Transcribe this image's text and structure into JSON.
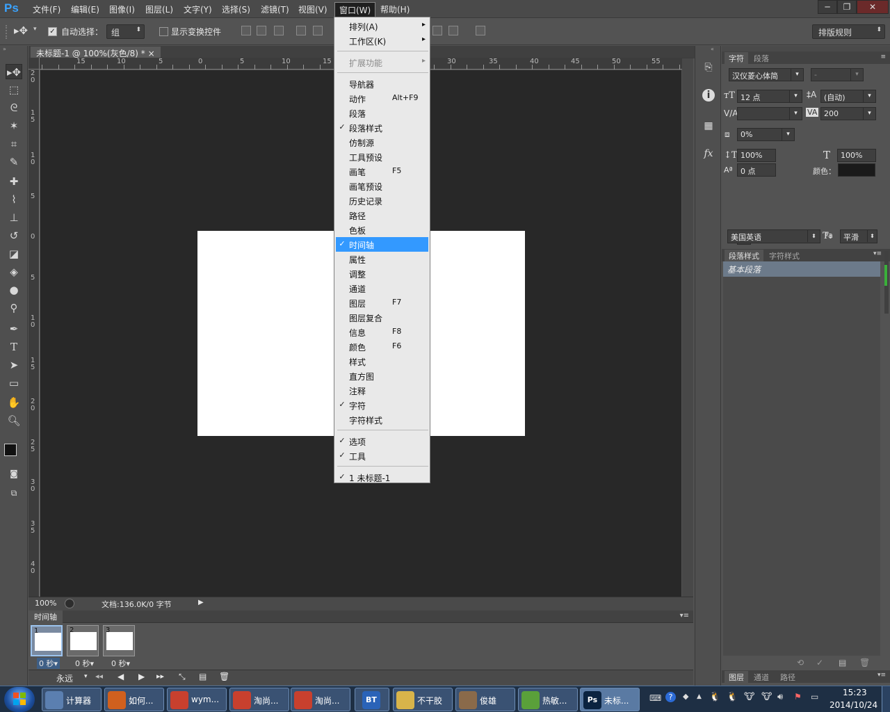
{
  "app": {
    "logo": "Ps"
  },
  "menubar": [
    "文件(F)",
    "编辑(E)",
    "图像(I)",
    "图层(L)",
    "文字(Y)",
    "选择(S)",
    "滤镜(T)",
    "视图(V)",
    "窗口(W)",
    "帮助(H)"
  ],
  "window_controls": [
    "─",
    "❐",
    "✕"
  ],
  "options": {
    "auto_select_label": "自动选择：",
    "auto_select_value": "组",
    "show_transform_label": "显示变换控件",
    "workspace": "排版规则"
  },
  "document": {
    "tab_title": "未标题-1 @ 100%(灰色/8) *",
    "tab_close": "×",
    "zoom": "100%",
    "doc_info": "文档:136.0K/0 字节"
  },
  "ruler": {
    "h_labels": [
      "15",
      "10",
      "5",
      "0",
      "5",
      "10",
      "15",
      "30",
      "35",
      "40",
      "45",
      "50",
      "55"
    ],
    "v_labels": [
      [
        "2",
        "0"
      ],
      [
        "1",
        "5"
      ],
      [
        "1",
        "0"
      ],
      [
        "5"
      ],
      [
        "0"
      ],
      [
        "5"
      ],
      [
        "1",
        "0"
      ],
      [
        "1",
        "5"
      ],
      [
        "2",
        "0"
      ],
      [
        "2",
        "5"
      ],
      [
        "3",
        "0"
      ],
      [
        "3",
        "5"
      ],
      [
        "4",
        "0"
      ]
    ]
  },
  "window_menu": {
    "items": [
      {
        "label": "排列(A)",
        "shortcut": "",
        "type": "sub",
        "check": false
      },
      {
        "label": "工作区(K)",
        "shortcut": "",
        "type": "sub",
        "check": false
      },
      {
        "type": "sep"
      },
      {
        "label": "扩展功能",
        "shortcut": "",
        "type": "disabled-sub",
        "check": false
      },
      {
        "type": "sep"
      },
      {
        "label": "导航器",
        "shortcut": "",
        "check": false
      },
      {
        "label": "动作",
        "shortcut": "Alt+F9",
        "check": false
      },
      {
        "label": "段落",
        "shortcut": "",
        "check": false
      },
      {
        "label": "段落样式",
        "shortcut": "",
        "check": true
      },
      {
        "label": "仿制源",
        "shortcut": "",
        "check": false
      },
      {
        "label": "工具预设",
        "shortcut": "",
        "check": false
      },
      {
        "label": "画笔",
        "shortcut": "F5",
        "check": false
      },
      {
        "label": "画笔预设",
        "shortcut": "",
        "check": false
      },
      {
        "label": "历史记录",
        "shortcut": "",
        "check": false
      },
      {
        "label": "路径",
        "shortcut": "",
        "check": false
      },
      {
        "label": "色板",
        "shortcut": "",
        "check": false
      },
      {
        "label": "时间轴",
        "shortcut": "",
        "check": true,
        "highlighted": true
      },
      {
        "label": "属性",
        "shortcut": "",
        "check": false
      },
      {
        "label": "调整",
        "shortcut": "",
        "check": false
      },
      {
        "label": "通道",
        "shortcut": "",
        "check": false
      },
      {
        "label": "图层",
        "shortcut": "F7",
        "check": false
      },
      {
        "label": "图层复合",
        "shortcut": "",
        "check": false
      },
      {
        "label": "信息",
        "shortcut": "F8",
        "check": false
      },
      {
        "label": "颜色",
        "shortcut": "F6",
        "check": false
      },
      {
        "label": "样式",
        "shortcut": "",
        "check": false
      },
      {
        "label": "直方图",
        "shortcut": "",
        "check": false
      },
      {
        "label": "注释",
        "shortcut": "",
        "check": false
      },
      {
        "label": "字符",
        "shortcut": "",
        "check": true
      },
      {
        "label": "字符样式",
        "shortcut": "",
        "check": false
      },
      {
        "type": "sep"
      },
      {
        "label": "选项",
        "shortcut": "",
        "check": true
      },
      {
        "label": "工具",
        "shortcut": "",
        "check": true
      },
      {
        "type": "sep"
      },
      {
        "label": "1 未标题-1",
        "shortcut": "",
        "check": true
      }
    ]
  },
  "character_panel": {
    "tabs": [
      "字符",
      "段落"
    ],
    "font_family": "汉仪菱心体简",
    "font_style": "-",
    "font_size": "12 点",
    "leading": "(自动)",
    "kerning": "",
    "tracking": "200",
    "scale_tsume": "0%",
    "vertical_scale": "100%",
    "horizontal_scale": "100%",
    "baseline_shift": "0 点",
    "color_label": "颜色：",
    "color": "#1a1a1a",
    "style_buttons": [
      "T",
      "T",
      "TT",
      "Tт",
      "T¹",
      "T₁",
      "T",
      "Ŧ"
    ],
    "opentype_buttons": [
      "fi",
      "ℴ",
      "st",
      "𝒜",
      "aā",
      "T",
      "1st",
      "½"
    ],
    "language": "美国英语",
    "aa_label": "ªa",
    "antialias": "平滑"
  },
  "style_panel": {
    "tabs": [
      "段落样式",
      "字符样式"
    ],
    "items": [
      "基本段落"
    ]
  },
  "bottom_panel_tabs": [
    "图层",
    "通道",
    "路径"
  ],
  "timeline": {
    "title": "时间轴",
    "frames": [
      {
        "num": "1",
        "delay": "0 秒▾"
      },
      {
        "num": "2",
        "delay": "0 秒▾"
      },
      {
        "num": "3",
        "delay": "0 秒▾"
      }
    ],
    "loop": "永远"
  },
  "taskbar": {
    "items": [
      {
        "label": "计算器",
        "color": "#5b7fb0"
      },
      {
        "label": "如何...",
        "color": "#d0601e"
      },
      {
        "label": "wym...",
        "color": "#c8402e"
      },
      {
        "label": "淘尚...",
        "color": "#c8402e"
      },
      {
        "label": "淘尚...",
        "color": "#c8402e"
      },
      {
        "label": "",
        "icon_text": "BT",
        "color": "#2a63b8"
      },
      {
        "label": "不干胶",
        "color": "#d8b44a"
      },
      {
        "label": "俊雄",
        "color": "#8a6a4a"
      },
      {
        "label": "热敏...",
        "color": "#5aa03a"
      },
      {
        "label": "未标...",
        "icon_text": "Ps",
        "color": "#0b2340"
      }
    ],
    "time": "15:23",
    "date": "2014/10/24"
  }
}
